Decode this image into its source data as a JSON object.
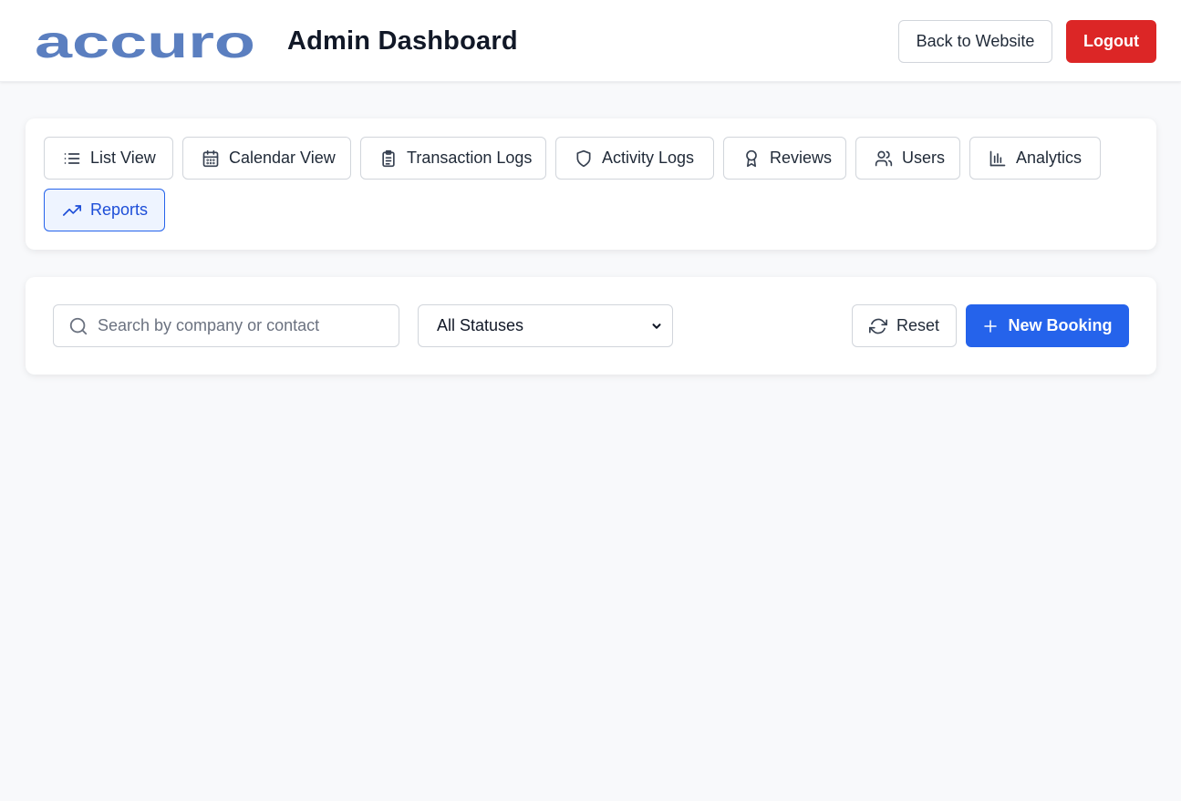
{
  "header": {
    "logo_text": "accuro",
    "title": "Admin Dashboard",
    "back_label": "Back to Website",
    "logout_label": "Logout"
  },
  "tabs": [
    {
      "label": "List View",
      "icon": "list-icon"
    },
    {
      "label": "Calendar View",
      "icon": "calendar-icon"
    },
    {
      "label": "Transaction Logs",
      "icon": "clipboard-icon"
    },
    {
      "label": "Activity Logs",
      "icon": "shield-icon"
    },
    {
      "label": "Reviews",
      "icon": "award-icon"
    },
    {
      "label": "Users",
      "icon": "users-icon"
    },
    {
      "label": "Analytics",
      "icon": "bar-chart-icon"
    },
    {
      "label": "Reports",
      "icon": "trending-up-icon",
      "active": true
    }
  ],
  "filters": {
    "search_placeholder": "Search by company or contact",
    "status_value": "All Statuses",
    "reset_label": "Reset",
    "new_booking_label": "New Booking"
  },
  "colors": {
    "logo": "#5b7fc0",
    "primary": "#2563eb",
    "danger": "#dc2626",
    "active_tab_bg": "#eef4ff"
  }
}
